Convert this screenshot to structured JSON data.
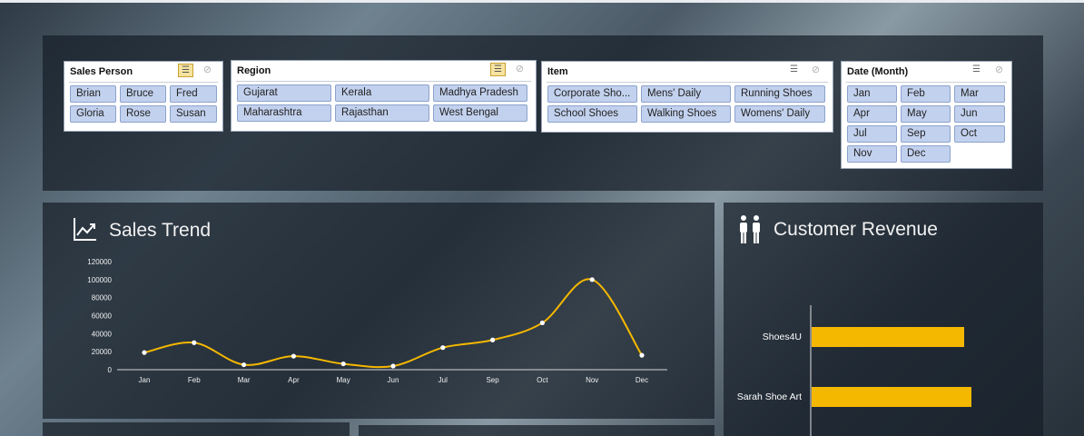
{
  "slicers": {
    "sales_person": {
      "title": "Sales Person",
      "items": [
        "Brian",
        "Bruce",
        "Fred",
        "Gloria",
        "Rose",
        "Susan"
      ]
    },
    "region": {
      "title": "Region",
      "items": [
        "Gujarat",
        "Kerala",
        "Madhya Pradesh",
        "Maharashtra",
        "Rajasthan",
        "West Bengal"
      ]
    },
    "item": {
      "title": "Item",
      "items": [
        "Corporate Sho...",
        "Mens' Daily",
        "Running Shoes",
        "School Shoes",
        "Walking Shoes",
        "Womens' Daily"
      ]
    },
    "date_month": {
      "title": "Date (Month)",
      "items": [
        "Jan",
        "Feb",
        "Mar",
        "Apr",
        "May",
        "Jun",
        "Jul",
        "Sep",
        "Oct",
        "Nov",
        "Dec"
      ]
    }
  },
  "sales_trend": {
    "title": "Sales Trend",
    "icon": "line-chart-icon"
  },
  "customer_revenue": {
    "title": "Customer Revenue",
    "icon": "people-icon"
  },
  "colors": {
    "accent": "#f5b800",
    "chip_bg": "#c2d1ee",
    "panel_bg": "#161e28"
  },
  "chart_data": [
    {
      "type": "line",
      "categories": [
        "Jan",
        "Feb",
        "Mar",
        "Apr",
        "May",
        "Jun",
        "Jul",
        "Sep",
        "Oct",
        "Nov",
        "Dec"
      ],
      "values": [
        19000,
        30000,
        5500,
        15000,
        6500,
        4000,
        24500,
        33000,
        52000,
        100000,
        16000
      ],
      "y_ticks": [
        "0",
        "20000",
        "40000",
        "60000",
        "80000",
        "100000",
        "120000"
      ],
      "ylim": [
        0,
        120000
      ]
    },
    {
      "type": "bar",
      "orientation": "horizontal",
      "categories": [
        "Shoes4U",
        "Sarah Shoe Art"
      ],
      "values": [
        0.84,
        0.88
      ]
    }
  ]
}
